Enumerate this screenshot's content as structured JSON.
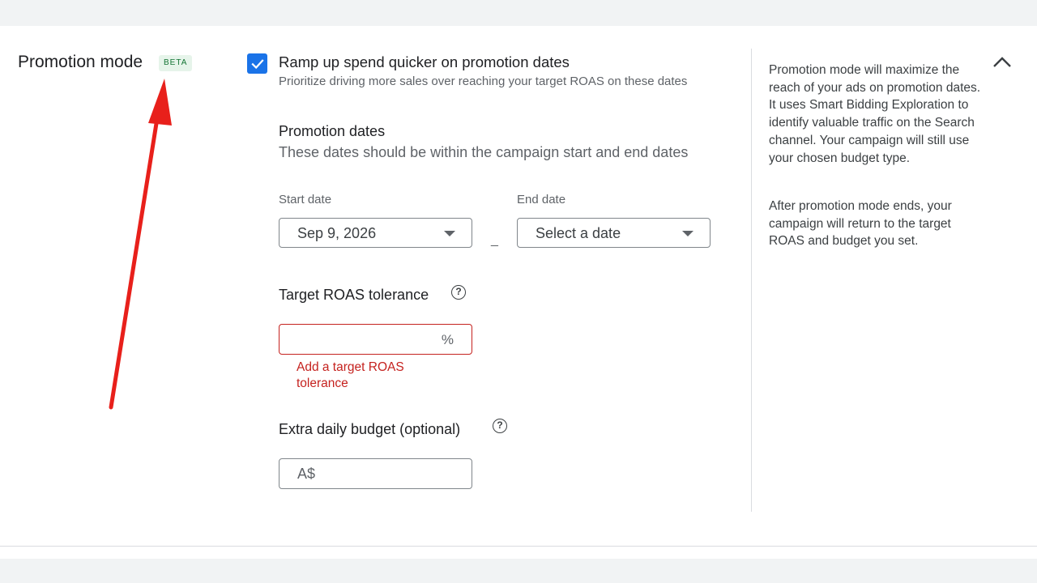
{
  "section": {
    "title": "Promotion mode",
    "badge": "BETA",
    "collapse_icon": "chevron-up-icon"
  },
  "ramp_up": {
    "checked": true,
    "label": "Ramp up spend quicker on promotion dates",
    "sublabel": "Prioritize driving more sales over reaching your target ROAS on these dates"
  },
  "promotion_dates": {
    "heading": "Promotion dates",
    "description": "These dates should be within the campaign start and end dates",
    "start_label": "Start date",
    "start_value": "Sep 9, 2026",
    "separator": "_",
    "end_label": "End date",
    "end_value": "Select a date"
  },
  "roas_tolerance": {
    "heading": "Target ROAS tolerance",
    "help_icon": "help-circle-icon",
    "suffix": "%",
    "error": "Add a target ROAS tolerance"
  },
  "extra_budget": {
    "heading": "Extra daily budget (optional)",
    "help_icon": "help-circle-icon",
    "prefix": "A$"
  },
  "help_panel": {
    "paragraph1": "Promotion mode will maximize the reach of your ads on promotion dates. It uses Smart Bidding Exploration to identify valuable traffic on the Search channel. Your campaign will still use your chosen budget type.",
    "paragraph2": "After promotion mode ends, your campaign will return to the target ROAS and budget you set."
  },
  "colors": {
    "accent": "#1a73e8",
    "error": "#c5221f",
    "beta_bg": "#e6f4ea",
    "beta_text": "#137333",
    "annotation_arrow": "#e8201b"
  }
}
